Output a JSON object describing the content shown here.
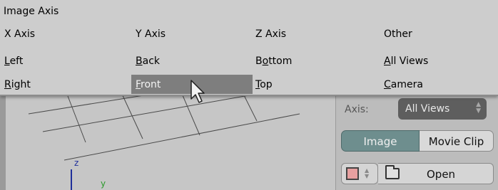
{
  "menu": {
    "title": "Image Axis",
    "headers": [
      "X Axis",
      "Y Axis",
      "Z Axis",
      "Other"
    ],
    "rows": [
      [
        {
          "label": "Left",
          "key": "L",
          "rest": "eft"
        },
        {
          "label": "Back",
          "key": "B",
          "rest": "ack"
        },
        {
          "label": "Bottom",
          "key": "o",
          "pre": "B",
          "rest": "ttom"
        },
        {
          "label": "All Views",
          "key": "A",
          "rest": "ll Views"
        }
      ],
      [
        {
          "label": "Right",
          "key": "R",
          "rest": "ight"
        },
        {
          "label": "Front",
          "key": "F",
          "rest": "ront",
          "highlighted": true
        },
        {
          "label": "Top",
          "key": "T",
          "rest": "op"
        },
        {
          "label": "Camera",
          "key": "C",
          "rest": "amera"
        }
      ]
    ]
  },
  "viewport": {
    "axis_z": "z",
    "axis_y": "y"
  },
  "panel": {
    "axis_label": "Axis:",
    "axis_value": "All Views",
    "source_tabs": [
      "Image",
      "Movie Clip"
    ],
    "active_source": "Image",
    "open_label": "Open"
  },
  "colors": {
    "menu_bg": "#cdcdcd",
    "menu_highlight": "#7e7e7e",
    "active_tab": "#6e8e8e",
    "axis_z": "#1f2f9a",
    "axis_y": "#2b9a2b"
  }
}
